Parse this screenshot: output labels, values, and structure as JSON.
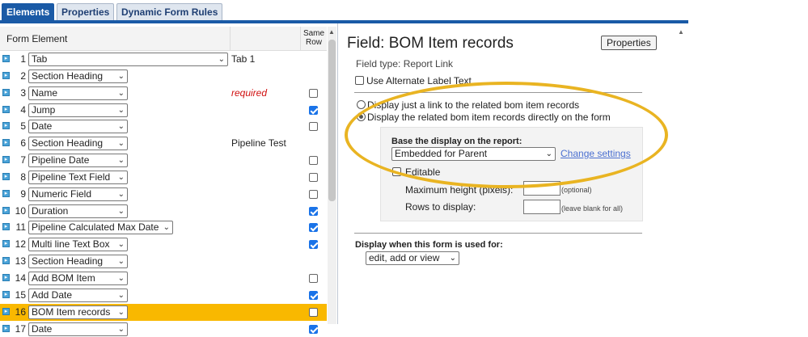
{
  "tabs": [
    {
      "label": "Elements"
    },
    {
      "label": "Properties"
    },
    {
      "label": "Dynamic Form Rules"
    }
  ],
  "left_panel": {
    "header_form_element": "Form Element",
    "header_same_row": "Same Row",
    "rows": [
      {
        "num": "1",
        "value": "Tab",
        "aux": "Tab 1",
        "checkbox": null
      },
      {
        "num": "2",
        "value": "Section Heading",
        "aux": "",
        "checkbox": null
      },
      {
        "num": "3",
        "value": "Name",
        "aux": "required",
        "checkbox": false
      },
      {
        "num": "4",
        "value": "Jump",
        "aux": "",
        "checkbox": true
      },
      {
        "num": "5",
        "value": "Date",
        "aux": "",
        "checkbox": false
      },
      {
        "num": "6",
        "value": "Section Heading",
        "aux": "Pipeline Test",
        "checkbox": null
      },
      {
        "num": "7",
        "value": "Pipeline Date",
        "aux": "",
        "checkbox": false
      },
      {
        "num": "8",
        "value": "Pipeline Text Field",
        "aux": "",
        "checkbox": false
      },
      {
        "num": "9",
        "value": "Numeric Field",
        "aux": "",
        "checkbox": false
      },
      {
        "num": "10",
        "value": "Duration",
        "aux": "",
        "checkbox": true
      },
      {
        "num": "11",
        "value": "Pipeline Calculated Max Date",
        "aux": "",
        "checkbox": true
      },
      {
        "num": "12",
        "value": "Multi line Text Box",
        "aux": "",
        "checkbox": true
      },
      {
        "num": "13",
        "value": "Section Heading",
        "aux": "",
        "checkbox": null
      },
      {
        "num": "14",
        "value": "Add BOM Item",
        "aux": "",
        "checkbox": false
      },
      {
        "num": "15",
        "value": "Add Date",
        "aux": "",
        "checkbox": true
      },
      {
        "num": "16",
        "value": "BOM Item records",
        "aux": "",
        "checkbox": false,
        "selected": true
      },
      {
        "num": "17",
        "value": "Date",
        "aux": "",
        "checkbox": true
      }
    ]
  },
  "right_panel": {
    "title": "Field: BOM Item records",
    "properties_button": "Properties",
    "field_type": "Field type: Report Link",
    "use_alt_label": "Use Alternate Label Text",
    "option_link": "Display just a link to the related bom item records",
    "option_direct": "Display the related bom item records directly on the form",
    "base_report_label": "Base the display on the report:",
    "base_report_value": "Embedded for Parent",
    "change_settings": "Change settings",
    "editable": "Editable",
    "max_height_label": "Maximum height (pixels):",
    "max_height_hint": "(optional)",
    "rows_label": "Rows to display:",
    "rows_hint": "(leave blank for all)",
    "display_when_label": "Display when this form is used for:",
    "display_when_value": "edit, add or view"
  },
  "colors": {
    "accent": "#1a5aa6",
    "selected_row": "#f9b800",
    "highlight_oval": "#e9b422",
    "link": "#4a6fd0",
    "required": "#d01010"
  }
}
